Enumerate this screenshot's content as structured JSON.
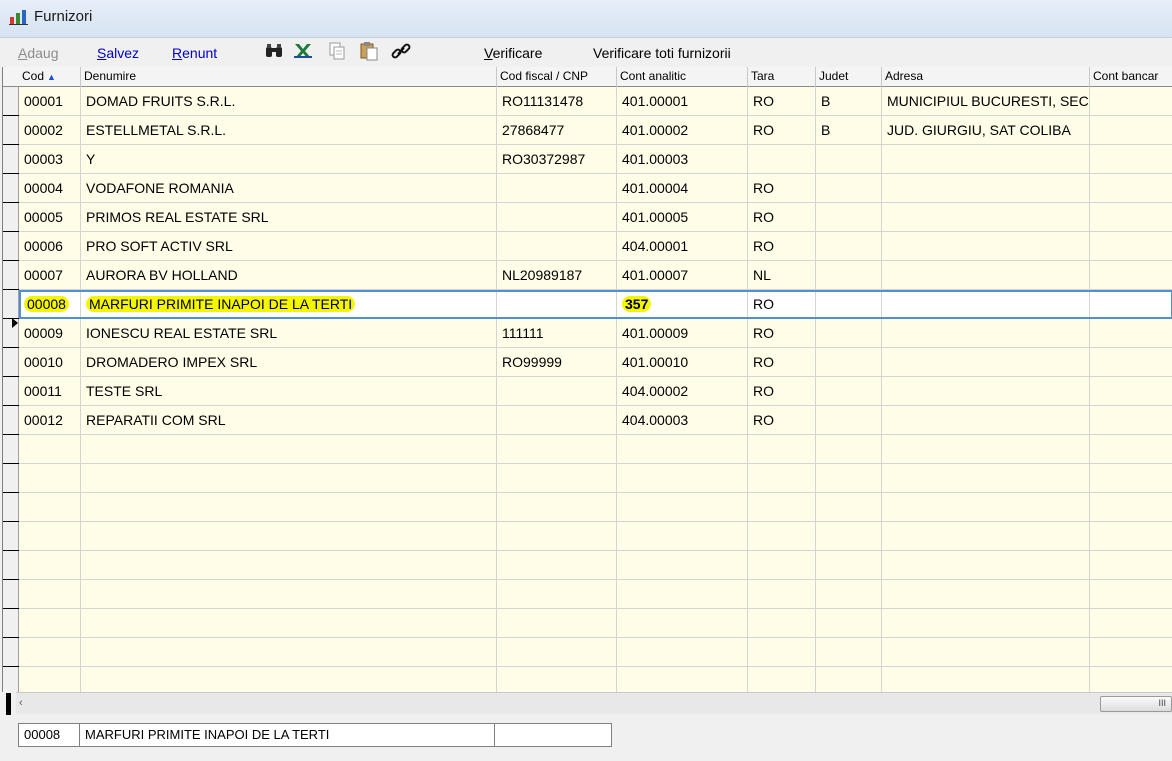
{
  "window": {
    "title": "Furnizori",
    "icon": "chart-icon"
  },
  "toolbar": {
    "add_label": "Adaug",
    "save_label": "Salvez",
    "cancel_label": "Renunt",
    "icons": [
      "binoculars-icon",
      "excel-icon",
      "copy-icon",
      "paste-icon",
      "link-icon"
    ],
    "verify_label": "Verificare",
    "verify_all_label": "Verificare toti furnizorii"
  },
  "grid": {
    "columns": [
      "Cod",
      "Denumire",
      "Cod fiscal / CNP",
      "Cont analitic",
      "Tara",
      "Judet",
      "Adresa",
      "Cont bancar"
    ],
    "sort_column": "Cod",
    "sort_direction": "ascending",
    "rows": [
      {
        "cod": "00001",
        "denumire": "DOMAD FRUITS S.R.L.",
        "cod_fiscal": "RO11131478",
        "cont": "401.00001",
        "tara": "RO",
        "judet": "B",
        "adresa": "MUNICIPIUL BUCURESTI, SEC",
        "cont_bancar": ""
      },
      {
        "cod": "00002",
        "denumire": "ESTELLMETAL S.R.L.",
        "cod_fiscal": "27868477",
        "cont": "401.00002",
        "tara": "RO",
        "judet": "B",
        "adresa": "JUD. GIURGIU, SAT COLIBA",
        "cont_bancar": ""
      },
      {
        "cod": "00003",
        "denumire": "Y",
        "cod_fiscal": "RO30372987",
        "cont": "401.00003",
        "tara": "",
        "judet": "",
        "adresa": "",
        "cont_bancar": ""
      },
      {
        "cod": "00004",
        "denumire": "VODAFONE ROMANIA",
        "cod_fiscal": "",
        "cont": "401.00004",
        "tara": "RO",
        "judet": "",
        "adresa": "",
        "cont_bancar": ""
      },
      {
        "cod": "00005",
        "denumire": "PRIMOS REAL ESTATE SRL",
        "cod_fiscal": "",
        "cont": "401.00005",
        "tara": "RO",
        "judet": "",
        "adresa": "",
        "cont_bancar": ""
      },
      {
        "cod": "00006",
        "denumire": "PRO SOFT ACTIV SRL",
        "cod_fiscal": "",
        "cont": "404.00001",
        "tara": "RO",
        "judet": "",
        "adresa": "",
        "cont_bancar": ""
      },
      {
        "cod": "00007",
        "denumire": "AURORA BV HOLLAND",
        "cod_fiscal": "NL20989187",
        "cont": "401.00007",
        "tara": "NL",
        "judet": "",
        "adresa": "",
        "cont_bancar": ""
      },
      {
        "cod": "00008",
        "denumire": "MARFURI PRIMITE INAPOI DE LA TERTI",
        "cod_fiscal": "",
        "cont": "357",
        "tara": "RO",
        "judet": "",
        "adresa": "",
        "cont_bancar": ""
      },
      {
        "cod": "00009",
        "denumire": "IONESCU REAL ESTATE SRL",
        "cod_fiscal": "111111",
        "cont": "401.00009",
        "tara": "RO",
        "judet": "",
        "adresa": "",
        "cont_bancar": ""
      },
      {
        "cod": "00010",
        "denumire": "DROMADERO IMPEX SRL",
        "cod_fiscal": "RO99999",
        "cont": "401.00010",
        "tara": "RO",
        "judet": "",
        "adresa": "",
        "cont_bancar": ""
      },
      {
        "cod": "00011",
        "denumire": "TESTE SRL",
        "cod_fiscal": "",
        "cont": "404.00002",
        "tara": "RO",
        "judet": "",
        "adresa": "",
        "cont_bancar": ""
      },
      {
        "cod": "00012",
        "denumire": "REPARATII COM SRL",
        "cod_fiscal": "",
        "cont": "404.00003",
        "tara": "RO",
        "judet": "",
        "adresa": "",
        "cont_bancar": ""
      }
    ],
    "selected_row": 7,
    "highlight_color": "#f4f500",
    "row_background": "#fffce8",
    "selection_border": "#4f8fd8"
  },
  "scrollbar": {
    "left_arrow": "‹",
    "thumb_grip": "III"
  },
  "footer": {
    "cod": "00008",
    "denumire": "MARFURI PRIMITE INAPOI DE LA TERTI",
    "extra": ""
  }
}
